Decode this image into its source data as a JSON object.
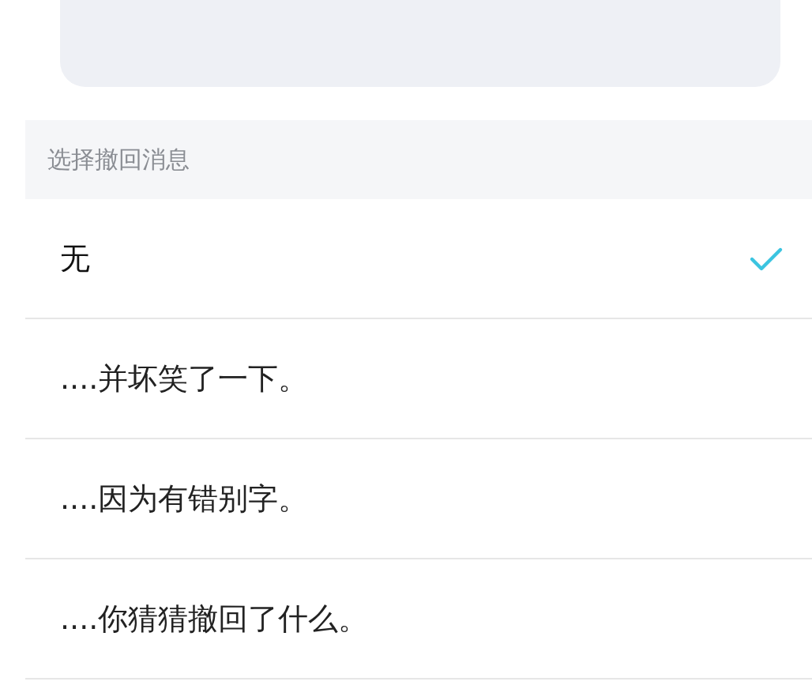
{
  "section": {
    "title": "选择撤回消息"
  },
  "options": [
    {
      "label": "无",
      "selected": true
    },
    {
      "label": "....并坏笑了一下。",
      "selected": false
    },
    {
      "label": "....因为有错别字。",
      "selected": false
    },
    {
      "label": "....你猜猜撤回了什么。",
      "selected": false
    }
  ]
}
